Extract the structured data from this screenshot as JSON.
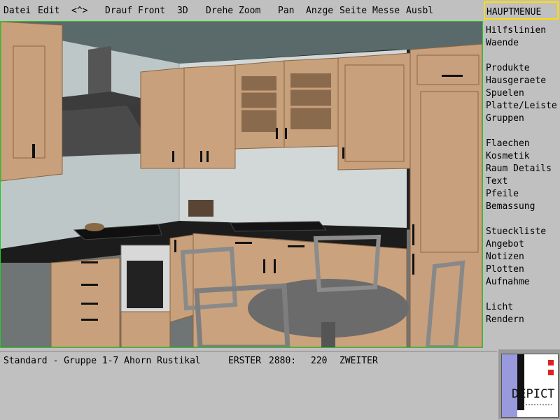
{
  "menubar": {
    "items": [
      "Datei",
      "Edit",
      "<^>",
      "Drauf",
      "Front",
      "3D",
      "Drehe",
      "Zoom",
      "Pan",
      "Anzge",
      "Seite",
      "Messe",
      "Ausbl"
    ]
  },
  "sidebar": {
    "title": "HAUPTMENUE",
    "groups": [
      [
        "Hilfslinien",
        "Waende"
      ],
      [
        "Produkte",
        "Hausgeraete",
        "Spuelen",
        "Platte/Leiste",
        "Gruppen"
      ],
      [
        "Flaechen",
        "Kosmetik",
        "Raum Details",
        "Text",
        "Pfeile",
        "Bemassung"
      ],
      [
        "Stueckliste",
        "Angebot",
        "Notizen",
        "Plotten",
        "Aufnahme"
      ],
      [
        "Licht",
        "Rendern"
      ]
    ]
  },
  "status": {
    "group": "Standard - Gruppe 1-7 Ahorn Rustikal",
    "first_label": "ERSTER",
    "x": "2880:",
    "y": "220",
    "second_label": "ZWEITER"
  },
  "logo": {
    "text": "DEPICT"
  },
  "colors": {
    "viewport_border": "#22cc22",
    "title_highlight": "#ffdd00",
    "wood": "#c9a07c",
    "counter": "#1c1c1c"
  }
}
